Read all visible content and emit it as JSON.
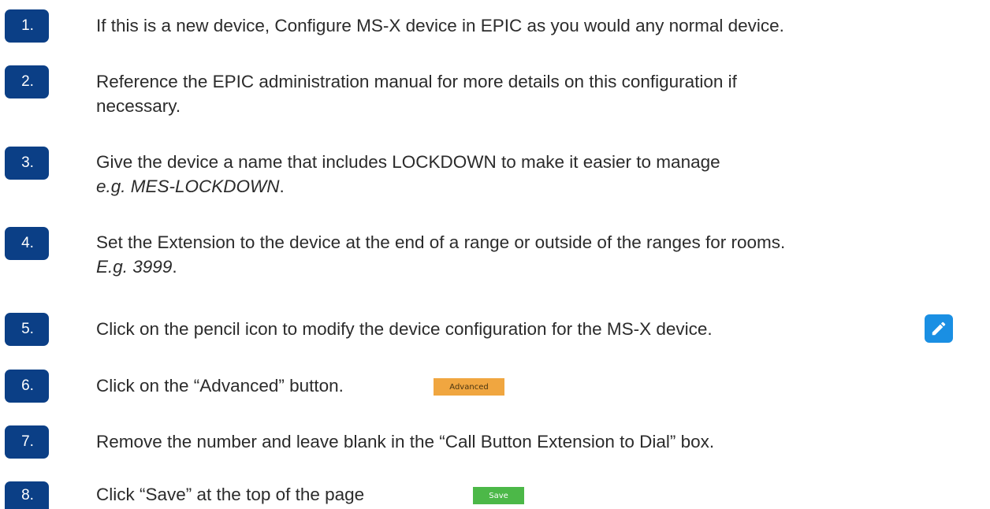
{
  "steps": [
    {
      "number": "1.",
      "lines": [
        "If this is a new device, Configure MS-X device in EPIC as you would any normal device."
      ]
    },
    {
      "number": "2.",
      "lines": [
        "Reference the EPIC administration manual for more details on this configuration if",
        "necessary."
      ]
    },
    {
      "number": "3.",
      "line1": "Give the device a name that includes LOCKDOWN to make it easier to manage",
      "line2_italic": "e.g. MES-LOCKDOWN",
      "line2_tail": "."
    },
    {
      "number": "4.",
      "line1": "Set the Extension to the device at the end of a range or outside of the ranges for rooms.",
      "line2_italic": "E.g. 3999",
      "line2_tail": "."
    },
    {
      "number": "5.",
      "lines": [
        "Click on the pencil icon to modify the device configuration for the MS-X device."
      ],
      "icon": "pencil-icon",
      "icon_color": "#1a8fe3"
    },
    {
      "number": "6.",
      "lines": [
        "Click on the “Advanced” button."
      ],
      "button_label": "Advanced",
      "button_color": "#f0a640"
    },
    {
      "number": "7.",
      "lines": [
        "Remove the number and leave blank in the “Call Button Extension to Dial” box."
      ]
    },
    {
      "number": "8.",
      "lines": [
        "Click “Save” at the top of the page"
      ],
      "button_label": "Save",
      "button_color": "#4cb848"
    }
  ],
  "colors": {
    "badge": "#0b3f86",
    "text": "#2b2b2b"
  }
}
